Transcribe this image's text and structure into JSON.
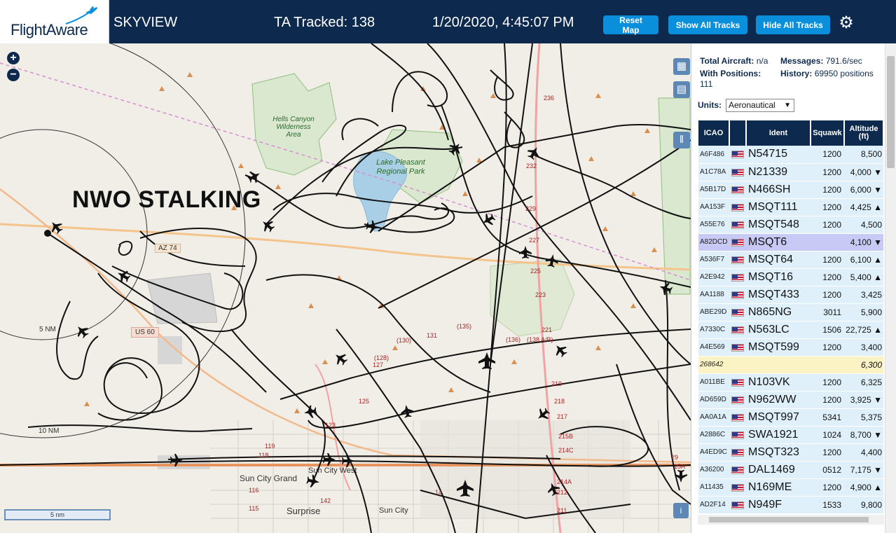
{
  "header": {
    "logo": "FlightAware",
    "title": "SKYVIEW",
    "tracked": "TA Tracked: 138",
    "datetime": "1/20/2020, 4:45:07 PM",
    "buttons": {
      "reset": "Reset Map",
      "show": "Show All Tracks",
      "hide": "Hide All Tracks"
    }
  },
  "map": {
    "overlay_text": "NWO STALKING",
    "labels": {
      "hells_canyon": "Hells Canyon Wilderness Area",
      "lake_pleasant": "Lake Pleasant Regional Park",
      "az74": "AZ 74",
      "us60": "US 60",
      "ring5": "5 NM",
      "ring10": "10 NM",
      "sun_city_grand": "Sun City Grand",
      "sun_city_west": "Sun City West",
      "surprise": "Surprise",
      "sun_city": "Sun City",
      "scale": "5 nm"
    },
    "route_numbers": [
      "236",
      "232",
      "229",
      "227",
      "225",
      "223",
      "221",
      "219",
      "218",
      "217",
      "215B",
      "214C",
      "214A",
      "212",
      "211",
      "(135)",
      "(136)",
      "(138 A/B)",
      "131",
      "(130)",
      "(128)",
      "127",
      "125",
      "123",
      "119",
      "118",
      "116",
      "115",
      "142",
      "14",
      "29",
      "15A"
    ]
  },
  "sidebar": {
    "total_aircraft_label": "Total Aircraft:",
    "total_aircraft_value": "n/a",
    "messages_label": "Messages:",
    "messages_value": "791.6/sec",
    "with_positions_label": "With Positions:",
    "with_positions_value": "111",
    "history_label": "History:",
    "history_value": "69950 positions",
    "units_label": "Units:",
    "units_value": "Aeronautical",
    "columns": [
      "ICAO",
      "",
      "Ident",
      "Squawk",
      "Altitude (ft)"
    ],
    "rows": [
      {
        "icao": "A6F486",
        "ident": "N54715",
        "squawk": "1200",
        "alt": "8,500"
      },
      {
        "icao": "A1C78A",
        "ident": "N21339",
        "squawk": "1200",
        "alt": "4,000 ▼"
      },
      {
        "icao": "A5B17D",
        "ident": "N466SH",
        "squawk": "1200",
        "alt": "6,000 ▼"
      },
      {
        "icao": "AA153F",
        "ident": "MSQT111",
        "squawk": "1200",
        "alt": "4,425 ▲"
      },
      {
        "icao": "A55E76",
        "ident": "MSQT548",
        "squawk": "1200",
        "alt": "4,500"
      },
      {
        "icao": "A82DCD",
        "ident": "MSQT6",
        "squawk": "",
        "alt": "4,100 ▼",
        "selected": true
      },
      {
        "icao": "A536F7",
        "ident": "MSQT64",
        "squawk": "1200",
        "alt": "6,100 ▲"
      },
      {
        "icao": "A2E942",
        "ident": "MSQT16",
        "squawk": "1200",
        "alt": "5,400 ▲"
      },
      {
        "icao": "AA1188",
        "ident": "MSQT433",
        "squawk": "1200",
        "alt": "3,425"
      },
      {
        "icao": "ABE29D",
        "ident": "N865NG",
        "squawk": "3011",
        "alt": "5,900"
      },
      {
        "icao": "A7330C",
        "ident": "N563LC",
        "squawk": "1506",
        "alt": "22,725 ▲"
      },
      {
        "icao": "A4E569",
        "ident": "MSQT599",
        "squawk": "1200",
        "alt": "3,400"
      },
      {
        "icao": "268642",
        "ident": "",
        "squawk": "",
        "alt": "6,300",
        "unknown": true
      },
      {
        "icao": "A011BE",
        "ident": "N103VK",
        "squawk": "1200",
        "alt": "6,325"
      },
      {
        "icao": "AD659D",
        "ident": "N962WW",
        "squawk": "1200",
        "alt": "3,925 ▼"
      },
      {
        "icao": "AA0A1A",
        "ident": "MSQT997",
        "squawk": "5341",
        "alt": "5,375"
      },
      {
        "icao": "A2886C",
        "ident": "SWA1921",
        "squawk": "1024",
        "alt": "8,700 ▼"
      },
      {
        "icao": "A4ED9C",
        "ident": "MSQT323",
        "squawk": "1200",
        "alt": "4,400"
      },
      {
        "icao": "A36200",
        "ident": "DAL1469",
        "squawk": "0512",
        "alt": "7,175 ▼"
      },
      {
        "icao": "A11435",
        "ident": "N169ME",
        "squawk": "1200",
        "alt": "4,900 ▲"
      },
      {
        "icao": "AD2F14",
        "ident": "N949F",
        "squawk": "1533",
        "alt": "9,800"
      }
    ]
  },
  "colors": {
    "header_bg": "#0d2a4e",
    "button_bg": "#0a8fdc",
    "row_bg": "#dff0fb",
    "selected_row": "#c8c9f4",
    "unknown_row": "#fbf3c4"
  },
  "icons": [
    "flightaware-logo-plane",
    "gear-icon",
    "zoom-in-icon",
    "zoom-out-icon",
    "map-layer-icon",
    "grid-icon",
    "columns-icon",
    "us-flag-icon",
    "plane-icon"
  ]
}
